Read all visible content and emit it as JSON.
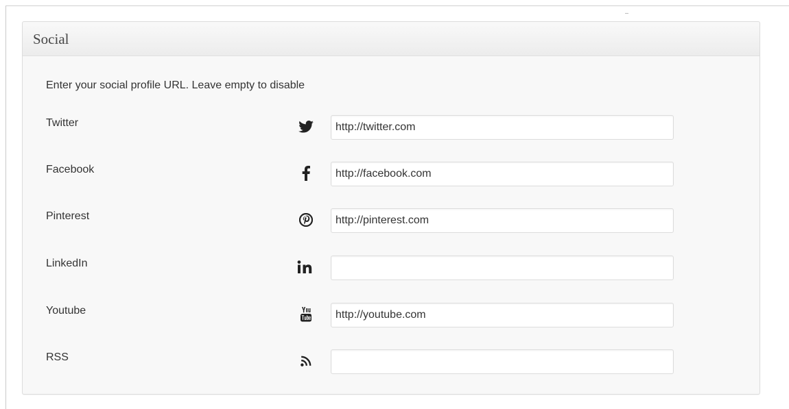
{
  "panel": {
    "title": "Social",
    "description": "Enter your social profile URL. Leave empty to disable"
  },
  "fields": [
    {
      "label": "Twitter",
      "icon": "twitter-icon",
      "value": "http://twitter.com"
    },
    {
      "label": "Facebook",
      "icon": "facebook-icon",
      "value": "http://facebook.com"
    },
    {
      "label": "Pinterest",
      "icon": "pinterest-icon",
      "value": "http://pinterest.com"
    },
    {
      "label": "LinkedIn",
      "icon": "linkedin-icon",
      "value": ""
    },
    {
      "label": "Youtube",
      "icon": "youtube-icon",
      "value": "http://youtube.com"
    },
    {
      "label": "RSS",
      "icon": "rss-icon",
      "value": ""
    }
  ],
  "colors": {
    "panel_background": "#f8f8f8",
    "header_background": "#ececec",
    "icon_color": "#222222"
  }
}
